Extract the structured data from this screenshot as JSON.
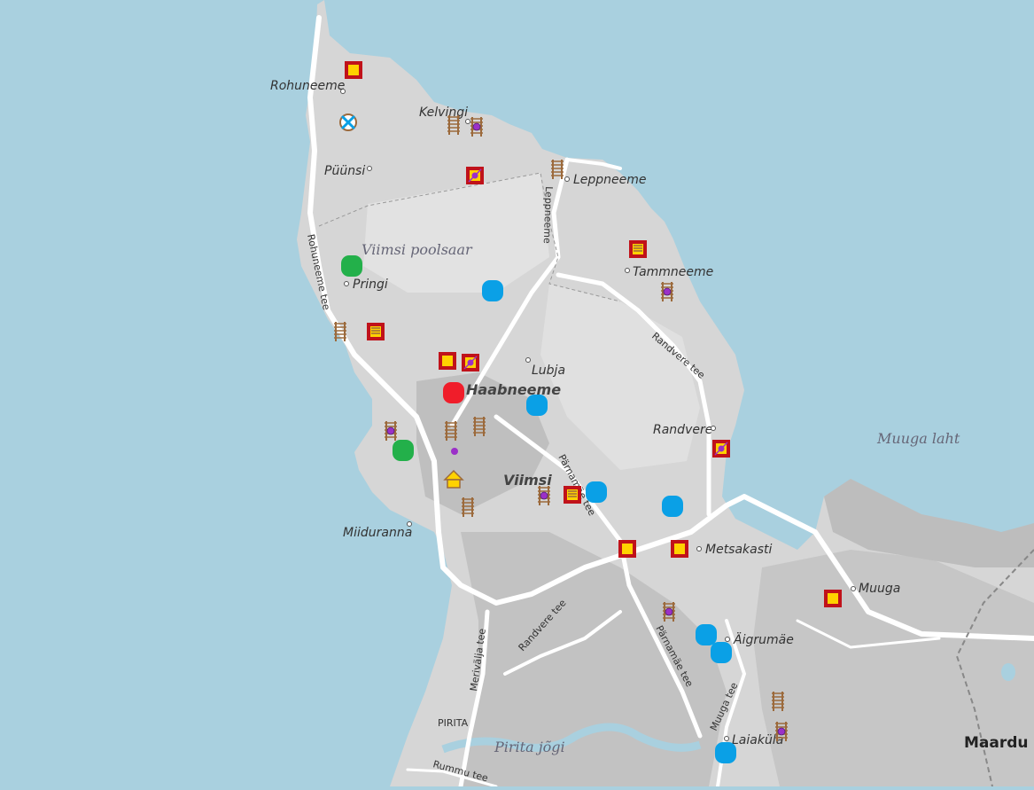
{
  "places": {
    "rohuneeme": "Rohuneeme",
    "kelvingi": "Kelvingi",
    "puunsi": "Püünsi",
    "leppneeme": "Leppneeme",
    "viimsi_poolsaar": "Viimsi poolsaar",
    "pringi": "Pringi",
    "tammneeme": "Tammneeme",
    "lubja": "Lubja",
    "haabneeme": "Haabneeme",
    "randvere": "Randvere",
    "muuga_laht": "Muuga laht",
    "viimsi": "Viimsi",
    "miiduranna": "Miiduranna",
    "metsakasti": "Metsakasti",
    "muuga": "Muuga",
    "aigrumae": "Äigrumäe",
    "pirita": "PIRITA",
    "pirita_jogi": "Pirita jõgi",
    "laiakula": "Laiaküla",
    "maardu": "Maardu"
  },
  "roads": {
    "rohuneeme_tee": "Rohuneeme tee",
    "leppneeme_tee": "Leppneeme",
    "randvere_tee": "Randvere tee",
    "parnamae_tee": "Pärnamäe tee",
    "randvere_tee_south": "Randvere tee",
    "parnamae_tee_south": "Pärnamäe tee",
    "merivalja_tee": "Merivälja tee",
    "muuga_tee": "Muuga tee",
    "rummu_tee": "Rummu tee"
  },
  "colors": {
    "sea": "#a9d0df",
    "land": "#d6d6d6",
    "land_dark": "#c4c4c4",
    "road": "#ffffff",
    "marker_yellow": "#ffd200",
    "marker_border": "#c0121a",
    "marker_blue": "#0aa0e6",
    "marker_green": "#23b04a",
    "marker_red": "#f01d2a",
    "marker_purple": "#9b30c8",
    "marker_brown": "#9c6a3c"
  },
  "icons": {
    "square": "yellow-square-icon",
    "framed_sign": "framed-sign-icon",
    "tower": "wooden-tower-icon",
    "tower_purple": "tower-purple-dot-icon",
    "blue_dot": "blue-area-icon",
    "green_dot": "green-area-icon",
    "red_dot": "red-area-icon",
    "wind": "windmill-icon",
    "house": "house-icon"
  }
}
